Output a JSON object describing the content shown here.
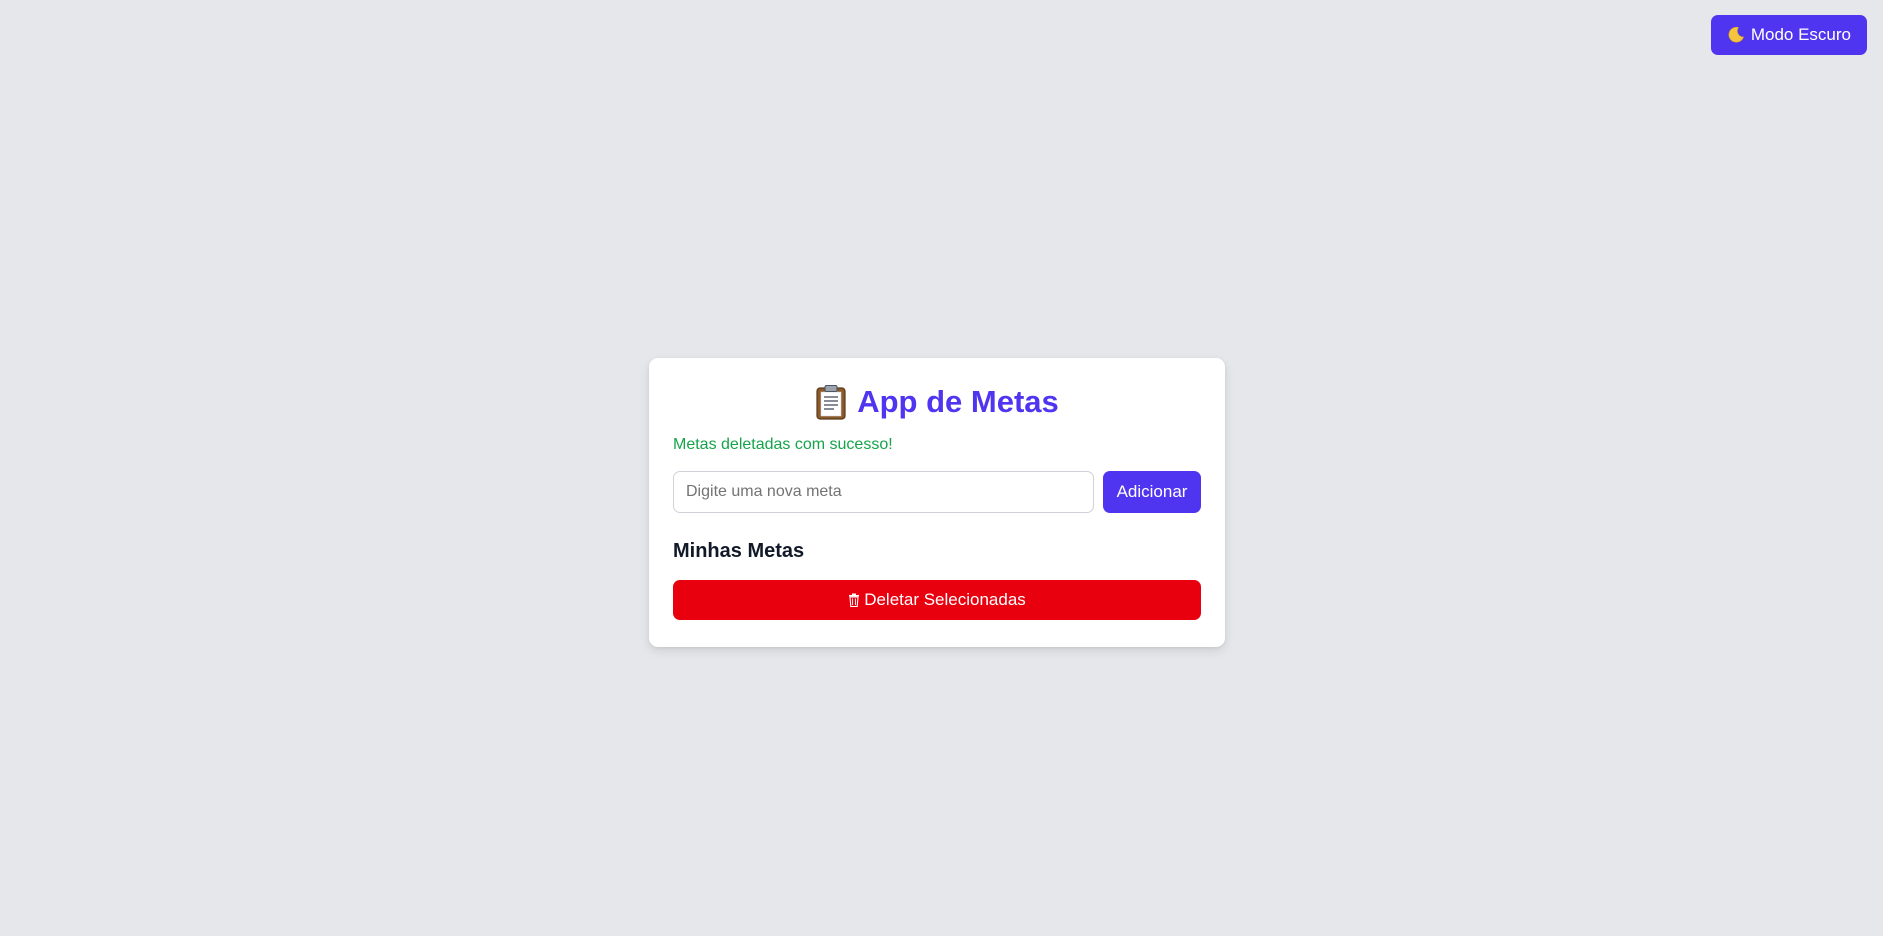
{
  "theme_toggle": {
    "icon": "moon-icon",
    "label": "Modo Escuro",
    "color": "#4f35f0"
  },
  "card": {
    "title_icon": "clipboard-icon",
    "title": "App de Metas",
    "title_color": "#4f35f0",
    "success_message": "Metas deletadas com sucesso!",
    "success_color": "#16a34a",
    "input": {
      "value": "",
      "placeholder": "Digite uma nova meta"
    },
    "add_label": "Adicionar",
    "section_title": "Minhas Metas",
    "delete_icon": "trash-icon",
    "delete_label": "Deletar Selecionadas",
    "delete_color": "#e8000f"
  }
}
